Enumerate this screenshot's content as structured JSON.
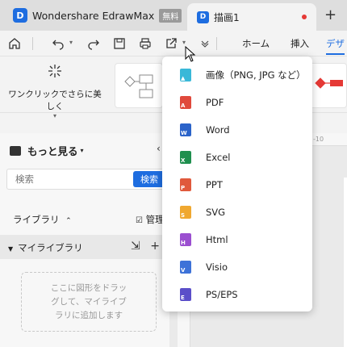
{
  "titlebar": {
    "app_name": "Wondershare EdrawMax",
    "free_badge": "無料",
    "doc_tab": "描画1",
    "new_tab": "+"
  },
  "toolbar": {
    "icons": {
      "home": "home-icon",
      "undo": "undo-icon",
      "redo": "redo-icon",
      "save": "save-icon",
      "print": "print-icon",
      "export": "export-icon",
      "more": "chevron-down-icon"
    },
    "menus": [
      "ホーム",
      "挿入",
      "デザ"
    ],
    "active_menu": "デザ"
  },
  "ribbon": {
    "beautify_label": "ワンクリックでさらに美しく"
  },
  "left_panel": {
    "title": "もっと見る",
    "search_placeholder": "検索",
    "search_button": "検索",
    "library_label": "ライブラリ",
    "manage_label": "管理",
    "my_library_label": "マイライブラリ",
    "drop_hint": "ここに図形をドラッグして、マイライブラリに追加します"
  },
  "ruler": {
    "tick_label": "-10"
  },
  "export_menu": {
    "items": [
      {
        "label": "画像（PNG, JPG など）",
        "icon": "image-file-icon",
        "color": "#39b8d8"
      },
      {
        "label": "PDF",
        "icon": "pdf-file-icon",
        "color": "#e0493c"
      },
      {
        "label": "Word",
        "icon": "word-file-icon",
        "color": "#2b63c9"
      },
      {
        "label": "Excel",
        "icon": "excel-file-icon",
        "color": "#1f8f4e"
      },
      {
        "label": "PPT",
        "icon": "ppt-file-icon",
        "color": "#e0593c"
      },
      {
        "label": "SVG",
        "icon": "svg-file-icon",
        "color": "#f0a830"
      },
      {
        "label": "Html",
        "icon": "html-file-icon",
        "color": "#9b4fd0"
      },
      {
        "label": "Visio",
        "icon": "visio-file-icon",
        "color": "#3d72d8"
      },
      {
        "label": "PS/EPS",
        "icon": "ps-eps-file-icon",
        "color": "#5b4fc9"
      }
    ]
  },
  "colors": {
    "accent": "#1e6de0",
    "tab_dot": "#e53935"
  }
}
